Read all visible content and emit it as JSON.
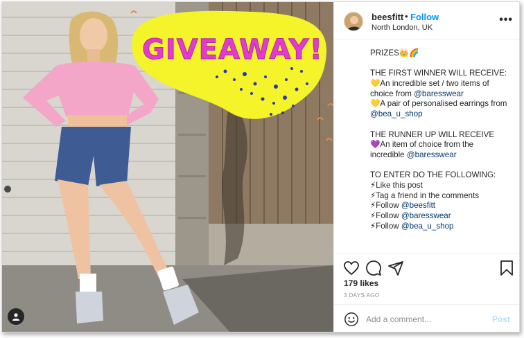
{
  "photo": {
    "overlay_text": "GIVEAWAY!",
    "colors": {
      "sticker": "#f5f32a",
      "sticker_text": "#e43ad1",
      "dots": "#2b34b8",
      "top": "#f4a6c9",
      "shorts": "#3e5c93"
    },
    "user_tag_icon": "person-icon"
  },
  "header": {
    "username": "beesfitt",
    "separator": "•",
    "follow_label": "Follow",
    "location": "North London, UK",
    "more_icon": "ellipsis-icon",
    "more_label": "•••"
  },
  "caption": {
    "lines": [
      {
        "type": "text",
        "text": "PRIZES👑🌈"
      },
      {
        "type": "gap"
      },
      {
        "type": "text",
        "text": "THE FIRST WINNER WILL RECEIVE:"
      },
      {
        "type": "text",
        "text": "💛An incredible set / two items of"
      },
      {
        "type": "mixed",
        "prefix": "choice from ",
        "mention": "@baresswear"
      },
      {
        "type": "text",
        "text": "💛A pair of personalised earrings from"
      },
      {
        "type": "mixed",
        "prefix": "",
        "mention": "@bea_u_shop"
      },
      {
        "type": "gap"
      },
      {
        "type": "text",
        "text": "THE RUNNER UP WILL RECEIVE"
      },
      {
        "type": "text",
        "text": "💜An item of choice from the"
      },
      {
        "type": "mixed",
        "prefix": "incredible ",
        "mention": "@baresswear"
      },
      {
        "type": "gap"
      },
      {
        "type": "text",
        "text": "TO ENTER DO THE FOLLOWING:"
      },
      {
        "type": "text",
        "text": "⚡Like this post"
      },
      {
        "type": "text",
        "text": "⚡Tag a friend in the comments"
      },
      {
        "type": "mixed",
        "prefix": "⚡Follow ",
        "mention": "@beesfitt"
      },
      {
        "type": "mixed",
        "prefix": "⚡Follow ",
        "mention": "@baresswear"
      },
      {
        "type": "mixed",
        "prefix": "⚡Follow ",
        "mention": "@bea_u_shop"
      }
    ]
  },
  "actions": {
    "icons": [
      "heart-icon",
      "comment-icon",
      "share-icon",
      "bookmark-icon"
    ],
    "likes": "179 likes",
    "date": "3 DAYS AGO"
  },
  "comment": {
    "placeholder": "Add a comment...",
    "post_label": "Post",
    "emoji_icon": "emoji-icon"
  }
}
